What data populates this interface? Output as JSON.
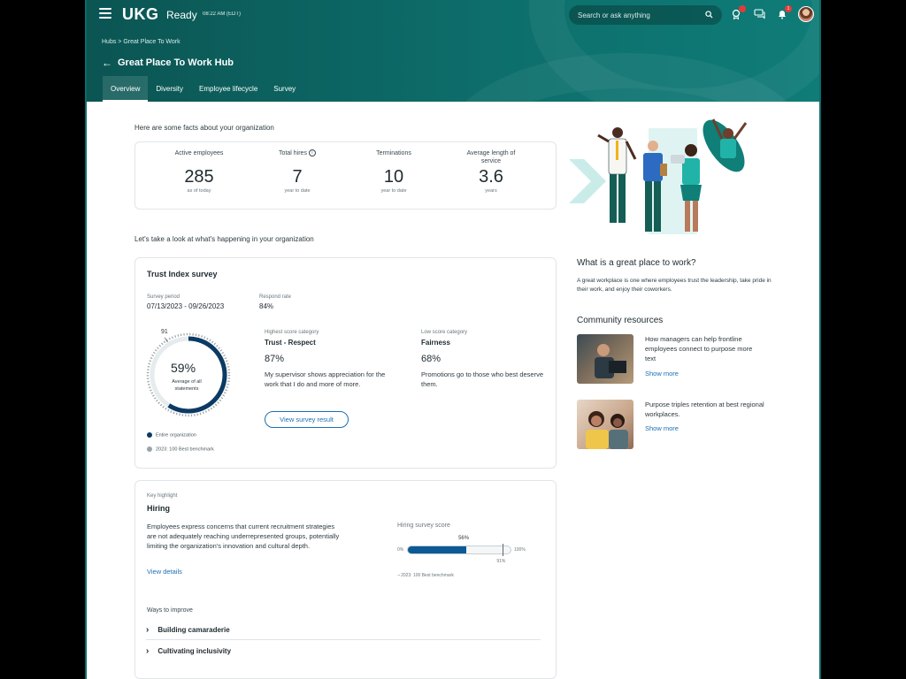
{
  "header": {
    "logo": "UKG",
    "logo_sub": "Ready",
    "clock": "08:22 AM (EDT)",
    "search_placeholder": "Search or ask anything",
    "notif_badge_1": "",
    "notif_badge_2": "1",
    "breadcrumb": "Hubs > Great Place To Work",
    "title": "Great Place To Work Hub",
    "tabs": [
      {
        "label": "Overview"
      },
      {
        "label": "Diversity"
      },
      {
        "label": "Employee lifecycle"
      },
      {
        "label": "Survey"
      }
    ]
  },
  "facts": {
    "intro": "Here are some facts about your organization",
    "items": [
      {
        "label": "Active employees",
        "value": "285",
        "sub": "as of today"
      },
      {
        "label": "Total hires",
        "value": "7",
        "sub": "year to date"
      },
      {
        "label": "Terminations",
        "value": "10",
        "sub": "year to date"
      },
      {
        "label": "Average length of service",
        "value": "3.6",
        "sub": "years"
      }
    ]
  },
  "happening_intro": "Let's take a look at what's happening in your organization",
  "trust": {
    "title": "Trust Index survey",
    "period_label": "Survey period",
    "period_value": "07/13/2023 - 09/26/2023",
    "respond_label": "Respond rate",
    "respond_value": "84%",
    "gauge": {
      "percent": 59,
      "percent_text": "59%",
      "caption": "Average of all statements",
      "benchmark": 91,
      "benchmark_text": "91"
    },
    "high_label": "Highest score category",
    "high_name": "Trust - Respect",
    "high_pct": "87%",
    "high_desc": "My supervisor shows appreciation for the work that I do and more of more.",
    "low_label": "Low score category",
    "low_name": "Fairness",
    "low_pct": "68%",
    "low_desc": "Promotions go to those who best deserve them.",
    "button": "View survey result",
    "legend_1": "Entire organization",
    "legend_2": "2023: 100 Best benchmark",
    "colors": {
      "primary": "#0b3a63",
      "benchmark": "#9aa3a8"
    }
  },
  "highlight": {
    "kicker": "Key highlight",
    "title": "Hiring",
    "desc": "Employees express concerns that current recruitment strategies are not adequately reaching underrepresented groups, potentially limiting the organization's innovation and cultural depth.",
    "link": "View details",
    "score_label": "Hiring survey score",
    "score": 56,
    "score_text": "56%",
    "benchmark": 91,
    "benchmark_text": "91%",
    "min_text": "0%",
    "max_text": "100%",
    "legend": "2023: 100 Best benchmark",
    "ways_label": "Ways to improve",
    "ways": [
      {
        "label": "Building camaraderie"
      },
      {
        "label": "Cultivating inclusivity"
      }
    ]
  },
  "side": {
    "what_title": "What is a great place to work?",
    "what_text": "A great workplace is one where employees trust the leadership, take pride in their work, and enjoy their coworkers.",
    "community_title": "Community resources",
    "resources": [
      {
        "text": "How managers can help frontline employees connect to purpose more text",
        "link": "Show more"
      },
      {
        "text": "Purpose triples retention at best regional workplaces.",
        "link": "Show more"
      }
    ]
  }
}
